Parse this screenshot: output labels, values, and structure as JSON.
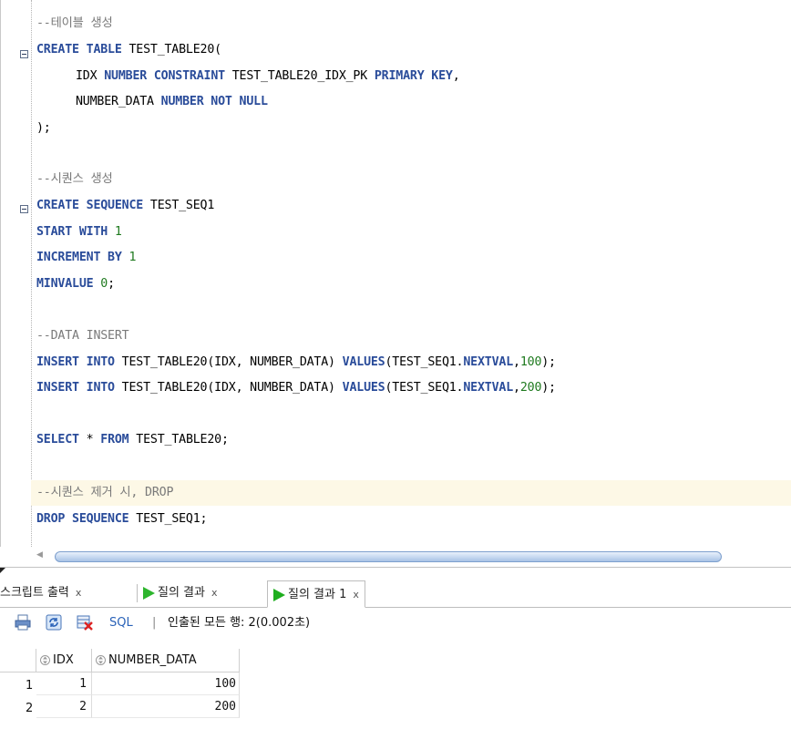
{
  "editor": {
    "lines": {
      "c1": "--테이블 생성",
      "c2_kw": "CREATE TABLE",
      "c2_rest": " TEST_TABLE20(",
      "c3_a": "IDX ",
      "c3_kw1": "NUMBER CONSTRAINT",
      "c3_b": " TEST_TABLE20_IDX_PK ",
      "c3_kw2": "PRIMARY KEY",
      "c3_c": ",",
      "c4_a": "NUMBER_DATA ",
      "c4_kw": "NUMBER NOT NULL",
      "c5": ");",
      "c6": "--시퀀스 생성",
      "c7_kw": "CREATE SEQUENCE",
      "c7_rest": " TEST_SEQ1",
      "c8_kw": "START WITH",
      "c8_num": "1",
      "c9_kw": "INCREMENT BY",
      "c9_num": "1",
      "c10_kw": "MINVALUE",
      "c10_num": "0",
      "c10_end": ";",
      "c11": "--DATA INSERT",
      "c12_kw1": "INSERT INTO",
      "c12_a": " TEST_TABLE20(IDX, NUMBER_DATA) ",
      "c12_kw2": "VALUES",
      "c12_b": "(TEST_SEQ1.",
      "c12_kw3": "NEXTVAL",
      "c12_c": ",",
      "c12_num": "100",
      "c12_d": ");",
      "c13_num": "200",
      "c14_kw1": "SELECT",
      "c14_a": " * ",
      "c14_kw2": "FROM",
      "c14_b": " TEST_TABLE20;",
      "c15": "--시퀀스 제거 시, DROP",
      "c16_kw": "DROP SEQUENCE",
      "c16_rest": " TEST_SEQ1;"
    }
  },
  "results": {
    "tabs": [
      {
        "label": "스크립트 출력",
        "close": "x"
      },
      {
        "label": "질의 결과",
        "close": "x"
      },
      {
        "label": "질의 결과 1",
        "close": "x"
      }
    ],
    "toolbar": {
      "sql_label": "SQL",
      "separator": "|",
      "status": "인출된 모든 행: 2(0.002초)"
    },
    "grid": {
      "columns": [
        "IDX",
        "NUMBER_DATA"
      ],
      "rows": [
        {
          "rownum": "1",
          "idx": "1",
          "number_data": "100"
        },
        {
          "rownum": "2",
          "idx": "2",
          "number_data": "200"
        }
      ]
    }
  },
  "colors": {
    "keyword": "#2a4c9a",
    "comment": "#7a7a7a",
    "number": "#1f7a1f",
    "highlight_line": "#fdf8e6"
  }
}
